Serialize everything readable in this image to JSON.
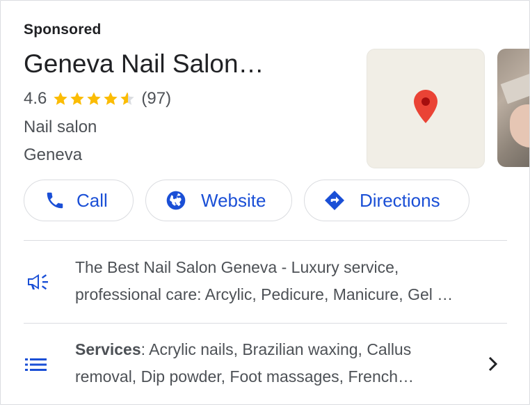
{
  "ad": {
    "sponsored_label": "Sponsored",
    "business_name": "Geneva Nail Salon…",
    "rating": {
      "value": "4.6",
      "stars": 4.6,
      "count": "(97)"
    },
    "category": "Nail salon",
    "location": "Geneva",
    "thumbnails": {
      "map_icon": "map-pin-icon",
      "photo": "salon-photo"
    }
  },
  "actions": {
    "call_label": "Call",
    "website_label": "Website",
    "directions_label": "Directions"
  },
  "description": {
    "line1": "The Best Nail Salon Geneva - Luxury service,",
    "line2": "professional care: Arcylic, Pedicure, Manicure, Gel …"
  },
  "services": {
    "label": "Services",
    "line1_rest": ": Acrylic nails, Brazilian waxing, Callus",
    "line2": "removal, Dip powder, Foot massages, French…"
  },
  "colors": {
    "accent_blue": "#1a4fd6",
    "star_yellow": "#fbbc04",
    "pin_red": "#ea4335",
    "text_gray": "#4d5156"
  }
}
